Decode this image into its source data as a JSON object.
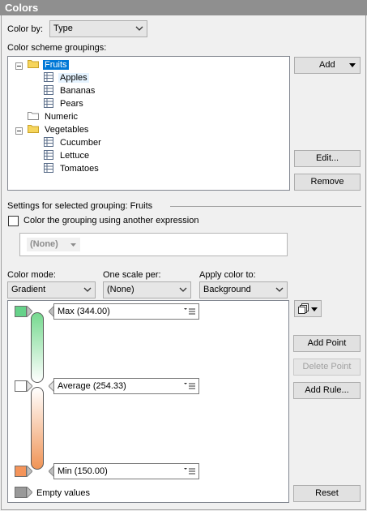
{
  "panel": {
    "title": "Colors"
  },
  "color_by": {
    "label": "Color by:",
    "value": "Type"
  },
  "groupings": {
    "label": "Color scheme groupings:",
    "tree": {
      "fruits": {
        "label": "Fruits",
        "children": [
          "Apples",
          "Bananas",
          "Pears"
        ]
      },
      "numeric": {
        "label": "Numeric"
      },
      "vegetables": {
        "label": "Vegetables",
        "children": [
          "Cucumber",
          "Lettuce",
          "Tomatoes"
        ]
      }
    },
    "buttons": {
      "add": "Add",
      "edit": "Edit...",
      "remove": "Remove"
    }
  },
  "settings": {
    "header": "Settings for selected grouping: Fruits",
    "use_expression_label": "Color the grouping using another expression",
    "use_expression_checked": false,
    "expression_value": "(None)"
  },
  "color_mode": {
    "label": "Color mode:",
    "value": "Gradient"
  },
  "one_scale": {
    "label": "One scale per:",
    "value": "(None)"
  },
  "apply_color": {
    "label": "Apply color to:",
    "value": "Background"
  },
  "gradient": {
    "points": [
      {
        "label": "Max (344.00)",
        "color": "#66d28a"
      },
      {
        "label": "Average (254.33)",
        "color": "#ffffff"
      },
      {
        "label": "Min (150.00)",
        "color": "#f4945a"
      }
    ],
    "empty_values": {
      "label": "Empty values",
      "color": "#999999"
    },
    "top_gradient": [
      "#76d98f",
      "#ffffff"
    ],
    "bottom_gradient": [
      "#ffffff",
      "#f09456"
    ]
  },
  "point_buttons": {
    "add_point": "Add Point",
    "delete_point": "Delete Point",
    "add_rule": "Add Rule...",
    "reset": "Reset"
  }
}
